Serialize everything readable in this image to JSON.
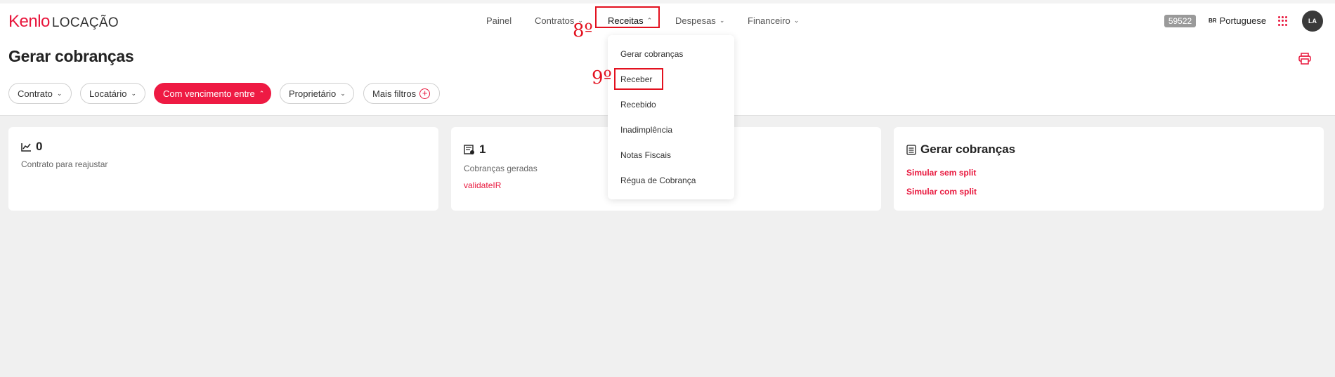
{
  "app": {
    "logo_part1": "Kenlo",
    "logo_part2": "LOCAÇÃO"
  },
  "nav": {
    "items": [
      {
        "label": "Painel",
        "chevron": ""
      },
      {
        "label": "Contratos",
        "chevron": "⌄"
      },
      {
        "label": "Receitas",
        "chevron": "⌃"
      },
      {
        "label": "Despesas",
        "chevron": "⌄"
      },
      {
        "label": "Financeiro",
        "chevron": "⌄"
      }
    ]
  },
  "annotations": {
    "step8": "8º",
    "step9": "9º"
  },
  "header_right": {
    "badge": "59522",
    "lang_flag": "BR",
    "lang_label": "Portuguese",
    "avatar_initials": "LA"
  },
  "page": {
    "title": "Gerar cobranças"
  },
  "filters": {
    "items": [
      {
        "label": "Contrato",
        "chevron": "⌄"
      },
      {
        "label": "Locatário",
        "chevron": "⌄"
      },
      {
        "label": "Com vencimento entre",
        "chevron": "⌃"
      },
      {
        "label": "Proprietário",
        "chevron": "⌄"
      },
      {
        "label": "Mais filtros",
        "chevron": ""
      }
    ],
    "plus_icon": "+"
  },
  "cards": {
    "reajuste": {
      "count": "0",
      "label": "Contrato para reajustar"
    },
    "cobrancas": {
      "count": "1",
      "label": "Cobranças geradas",
      "link": "validateIR"
    },
    "gerar": {
      "title": "Gerar cobranças",
      "link1": "Simular sem split",
      "link2": "Simular com split"
    }
  },
  "dropdown": {
    "items": [
      {
        "label": "Gerar cobranças"
      },
      {
        "label": "Receber"
      },
      {
        "label": "Recebido"
      },
      {
        "label": "Inadimplência"
      },
      {
        "label": "Notas Fiscais"
      },
      {
        "label": "Régua de Cobrança"
      }
    ]
  },
  "colors": {
    "brand": "#e8163c",
    "annotation": "#e3111f"
  }
}
